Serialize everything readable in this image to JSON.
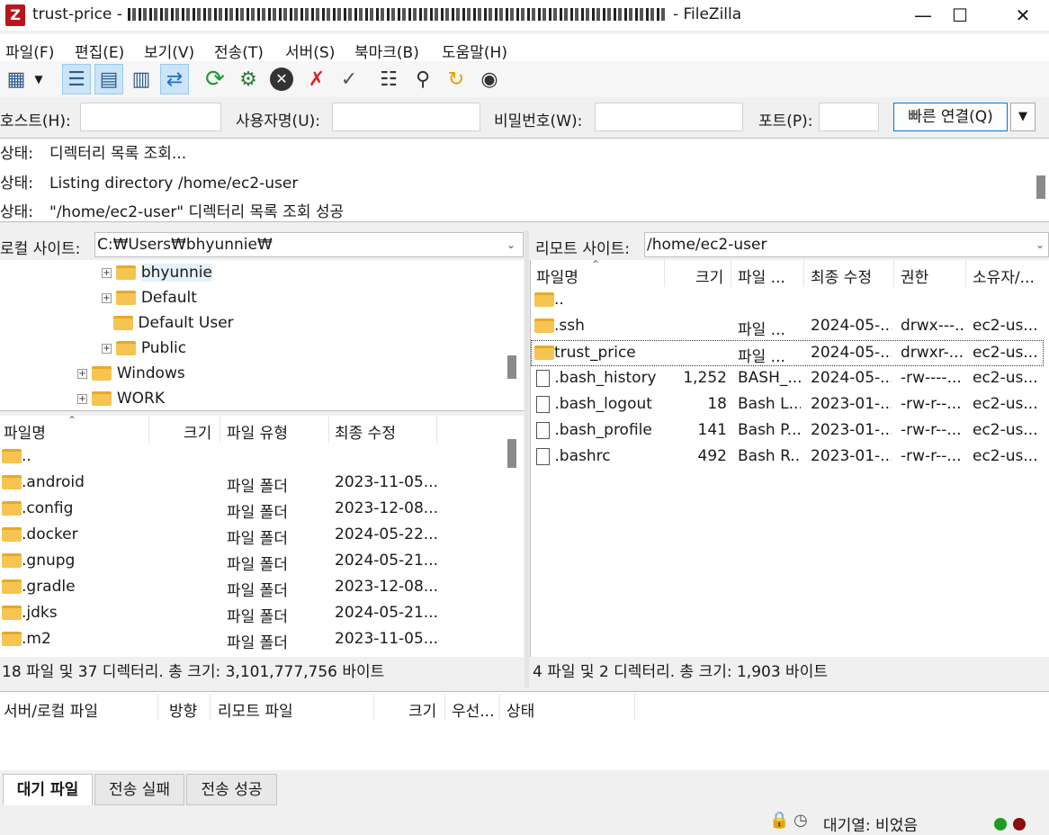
{
  "window": {
    "title_prefix": "trust-price -",
    "title_suffix": "- FileZilla",
    "app_icon": "Z",
    "minimize": "—",
    "maximize": "☐",
    "close": "✕"
  },
  "menu": [
    "파일(F)",
    "편집(E)",
    "보기(V)",
    "전송(T)",
    "서버(S)",
    "북마크(B)",
    "도움말(H)"
  ],
  "quickconnect": {
    "host_label": "호스트(H):",
    "user_label": "사용자명(U):",
    "pass_label": "비밀번호(W):",
    "port_label": "포트(P):",
    "button": "빠른 연결(Q)",
    "dropdown": "▼"
  },
  "log": [
    {
      "label": "상태:",
      "text": "디렉터리 목록 조회..."
    },
    {
      "label": "상태:",
      "text": "Listing directory /home/ec2-user"
    },
    {
      "label": "상태:",
      "text": "\"/home/ec2-user\" 디렉터리 목록 조회 성공"
    }
  ],
  "local": {
    "site_label": "로컬 사이트:",
    "path": "C:₩Users₩bhyunnie₩",
    "tree": [
      {
        "name": "bhyunnie",
        "expander": "+",
        "level": 2,
        "selected": true
      },
      {
        "name": "Default",
        "expander": "+",
        "level": 2
      },
      {
        "name": "Default User",
        "expander": "",
        "level": 2
      },
      {
        "name": "Public",
        "expander": "+",
        "level": 2
      },
      {
        "name": "Windows",
        "expander": "+",
        "level": 1
      },
      {
        "name": "WORK",
        "expander": "+",
        "level": 1
      }
    ],
    "columns": {
      "name": "파일명",
      "size": "크기",
      "type": "파일 유형",
      "modified": "최종 수정"
    },
    "files": [
      {
        "name": "..",
        "type": "",
        "modified": ""
      },
      {
        "name": ".android",
        "type": "파일 폴더",
        "modified": "2023-11-05..."
      },
      {
        "name": ".config",
        "type": "파일 폴더",
        "modified": "2023-12-08..."
      },
      {
        "name": ".docker",
        "type": "파일 폴더",
        "modified": "2024-05-22..."
      },
      {
        "name": ".gnupg",
        "type": "파일 폴더",
        "modified": "2024-05-21..."
      },
      {
        "name": ".gradle",
        "type": "파일 폴더",
        "modified": "2023-12-08..."
      },
      {
        "name": ".jdks",
        "type": "파일 폴더",
        "modified": "2024-05-21..."
      },
      {
        "name": ".m2",
        "type": "파일 폴더",
        "modified": "2023-11-05..."
      }
    ],
    "status": "18 파일 및 37 디렉터리. 총 크기: 3,101,777,756 바이트"
  },
  "remote": {
    "site_label": "리모트 사이트:",
    "path": "/home/ec2-user",
    "columns": {
      "name": "파일명",
      "size": "크기",
      "type": "파일 ...",
      "modified": "최종 수정",
      "perms": "권한",
      "owner": "소유자/..."
    },
    "files": [
      {
        "name": "..",
        "kind": "folder",
        "size": "",
        "type": "",
        "modified": "",
        "perms": "",
        "owner": ""
      },
      {
        "name": ".ssh",
        "kind": "folder",
        "size": "",
        "type": "파일 ...",
        "modified": "2024-05-...",
        "perms": "drwx---...",
        "owner": "ec2-us..."
      },
      {
        "name": "trust_price",
        "kind": "folder",
        "size": "",
        "type": "파일 ...",
        "modified": "2024-05-...",
        "perms": "drwxr-...",
        "owner": "ec2-us...",
        "focused": true
      },
      {
        "name": ".bash_history",
        "kind": "file",
        "size": "1,252",
        "type": "BASH_...",
        "modified": "2024-05-...",
        "perms": "-rw----...",
        "owner": "ec2-us..."
      },
      {
        "name": ".bash_logout",
        "kind": "file",
        "size": "18",
        "type": "Bash L...",
        "modified": "2023-01-...",
        "perms": "-rw-r--...",
        "owner": "ec2-us..."
      },
      {
        "name": ".bash_profile",
        "kind": "file",
        "size": "141",
        "type": "Bash P...",
        "modified": "2023-01-...",
        "perms": "-rw-r--...",
        "owner": "ec2-us..."
      },
      {
        "name": ".bashrc",
        "kind": "file",
        "size": "492",
        "type": "Bash R...",
        "modified": "2023-01-...",
        "perms": "-rw-r--...",
        "owner": "ec2-us..."
      }
    ],
    "status": "4 파일 및 2 디렉터리. 총 크기: 1,903 바이트"
  },
  "queue": {
    "columns": {
      "server_local": "서버/로컬 파일",
      "direction": "방향",
      "remote_file": "리모트 파일",
      "size": "크기",
      "priority": "우선...",
      "status": "상태"
    },
    "tabs": [
      "대기 파일",
      "전송 실패",
      "전송 성공"
    ]
  },
  "statusbar": {
    "queue": "대기열: 비었음"
  },
  "icons": [
    "site-manager-icon",
    "dropdown-arrow-icon",
    "message-log-icon",
    "local-tree-icon",
    "remote-tree-icon",
    "transfer-queue-icon",
    "refresh-icon",
    "filter-icon",
    "cancel-icon",
    "disconnect-icon",
    "reconnect-icon",
    "directory-compare-icon",
    "search-icon",
    "sync-browse-icon",
    "find-files-icon"
  ],
  "colors": {
    "accent": "#0078d7",
    "selection": "#cce4f7",
    "folder": "#f6c451",
    "logo": "#b8161b"
  }
}
